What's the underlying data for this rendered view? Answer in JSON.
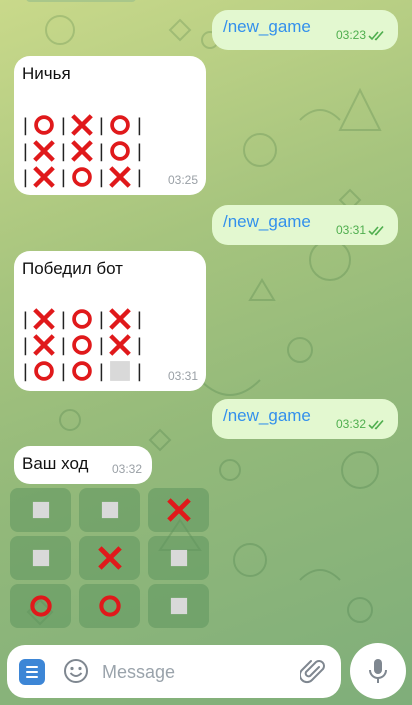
{
  "messages": {
    "out1": {
      "text": "/new_game",
      "time": "03:23"
    },
    "in1": {
      "title": "Ничья",
      "time": "03:25",
      "board": [
        [
          "O",
          "X",
          "O"
        ],
        [
          "X",
          "X",
          "O"
        ],
        [
          "X",
          "O",
          "X"
        ]
      ]
    },
    "out2": {
      "text": "/new_game",
      "time": "03:31"
    },
    "in2": {
      "title": "Победил бот",
      "time": "03:31",
      "board": [
        [
          "X",
          "O",
          "X"
        ],
        [
          "X",
          "O",
          "X"
        ],
        [
          "O",
          "O",
          "empty"
        ]
      ]
    },
    "out3": {
      "text": "/new_game",
      "time": "03:32"
    },
    "in3": {
      "title": "Ваш ход",
      "time": "03:32"
    }
  },
  "keyboard": {
    "cells": [
      "empty",
      "empty",
      "X",
      "empty",
      "X",
      "empty",
      "O",
      "O",
      "empty"
    ]
  },
  "composer": {
    "placeholder": "Message"
  },
  "icons": {
    "menu": "menu-icon",
    "emoji": "emoji-icon",
    "attach": "paperclip-icon",
    "mic": "microphone-icon",
    "read": "double-check-icon"
  },
  "colors": {
    "x_mark": "#e0191b",
    "o_mark": "#e0191b",
    "accent": "#3390ec",
    "outgoing_bubble": "#e3f8d0",
    "time_outgoing": "#4fae4e"
  }
}
